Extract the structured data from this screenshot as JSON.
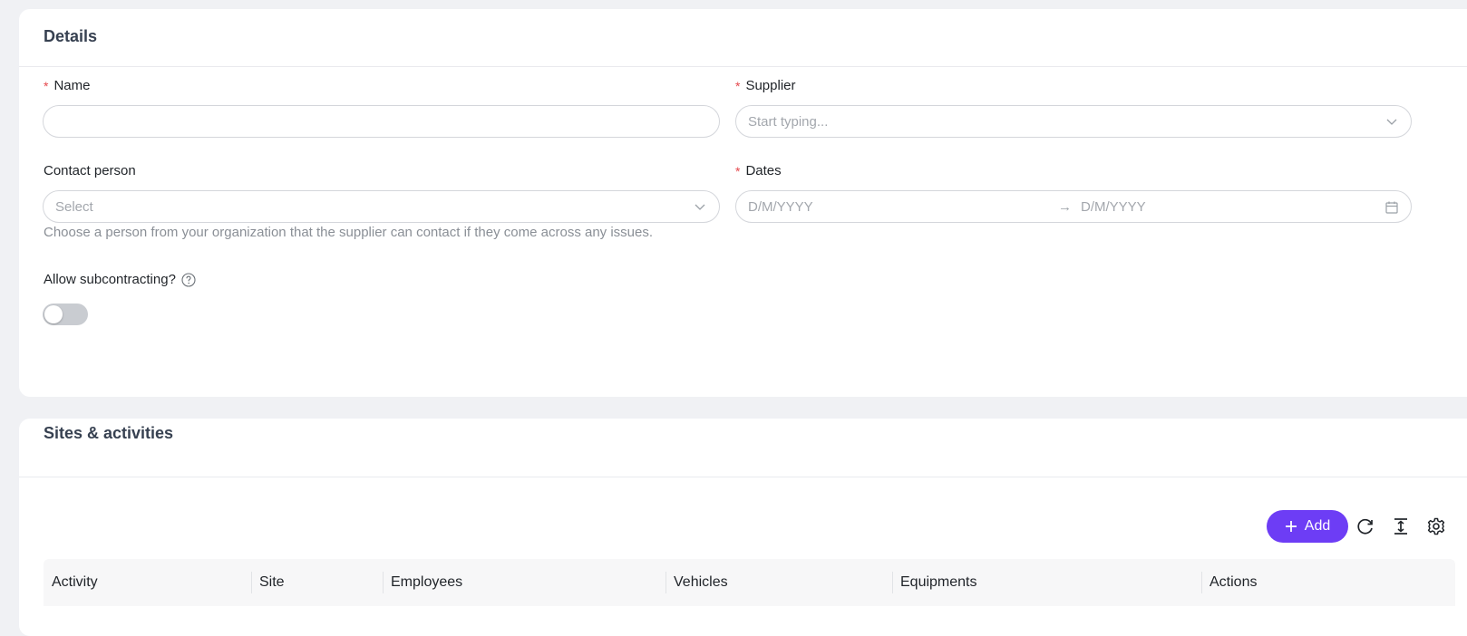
{
  "details": {
    "title": "Details",
    "name": {
      "label": "Name",
      "required_mark": "*",
      "value": ""
    },
    "supplier": {
      "label": "Supplier",
      "required_mark": "*",
      "placeholder": "Start typing..."
    },
    "contact_person": {
      "label": "Contact person",
      "placeholder": "Select",
      "hint": "Choose a person from your organization that the supplier can contact if they come across any issues."
    },
    "dates": {
      "label": "Dates",
      "required_mark": "*",
      "start_placeholder": "D/M/YYYY",
      "end_placeholder": "D/M/YYYY",
      "arrow": "→"
    },
    "subcontracting": {
      "label": "Allow subcontracting?",
      "enabled": false
    }
  },
  "sites": {
    "title": "Sites & activities",
    "add_button": {
      "icon": "plus-icon",
      "label": "Add"
    },
    "toolbar_icons": [
      "refresh-icon",
      "column-height-icon",
      "gear-icon"
    ],
    "columns": [
      "Activity",
      "Site",
      "Employees",
      "Vehicles",
      "Equipments",
      "Actions"
    ]
  },
  "colors": {
    "accent": "#6d3df5",
    "required": "#e5484d",
    "toggle_off": "#c9ccd1"
  }
}
